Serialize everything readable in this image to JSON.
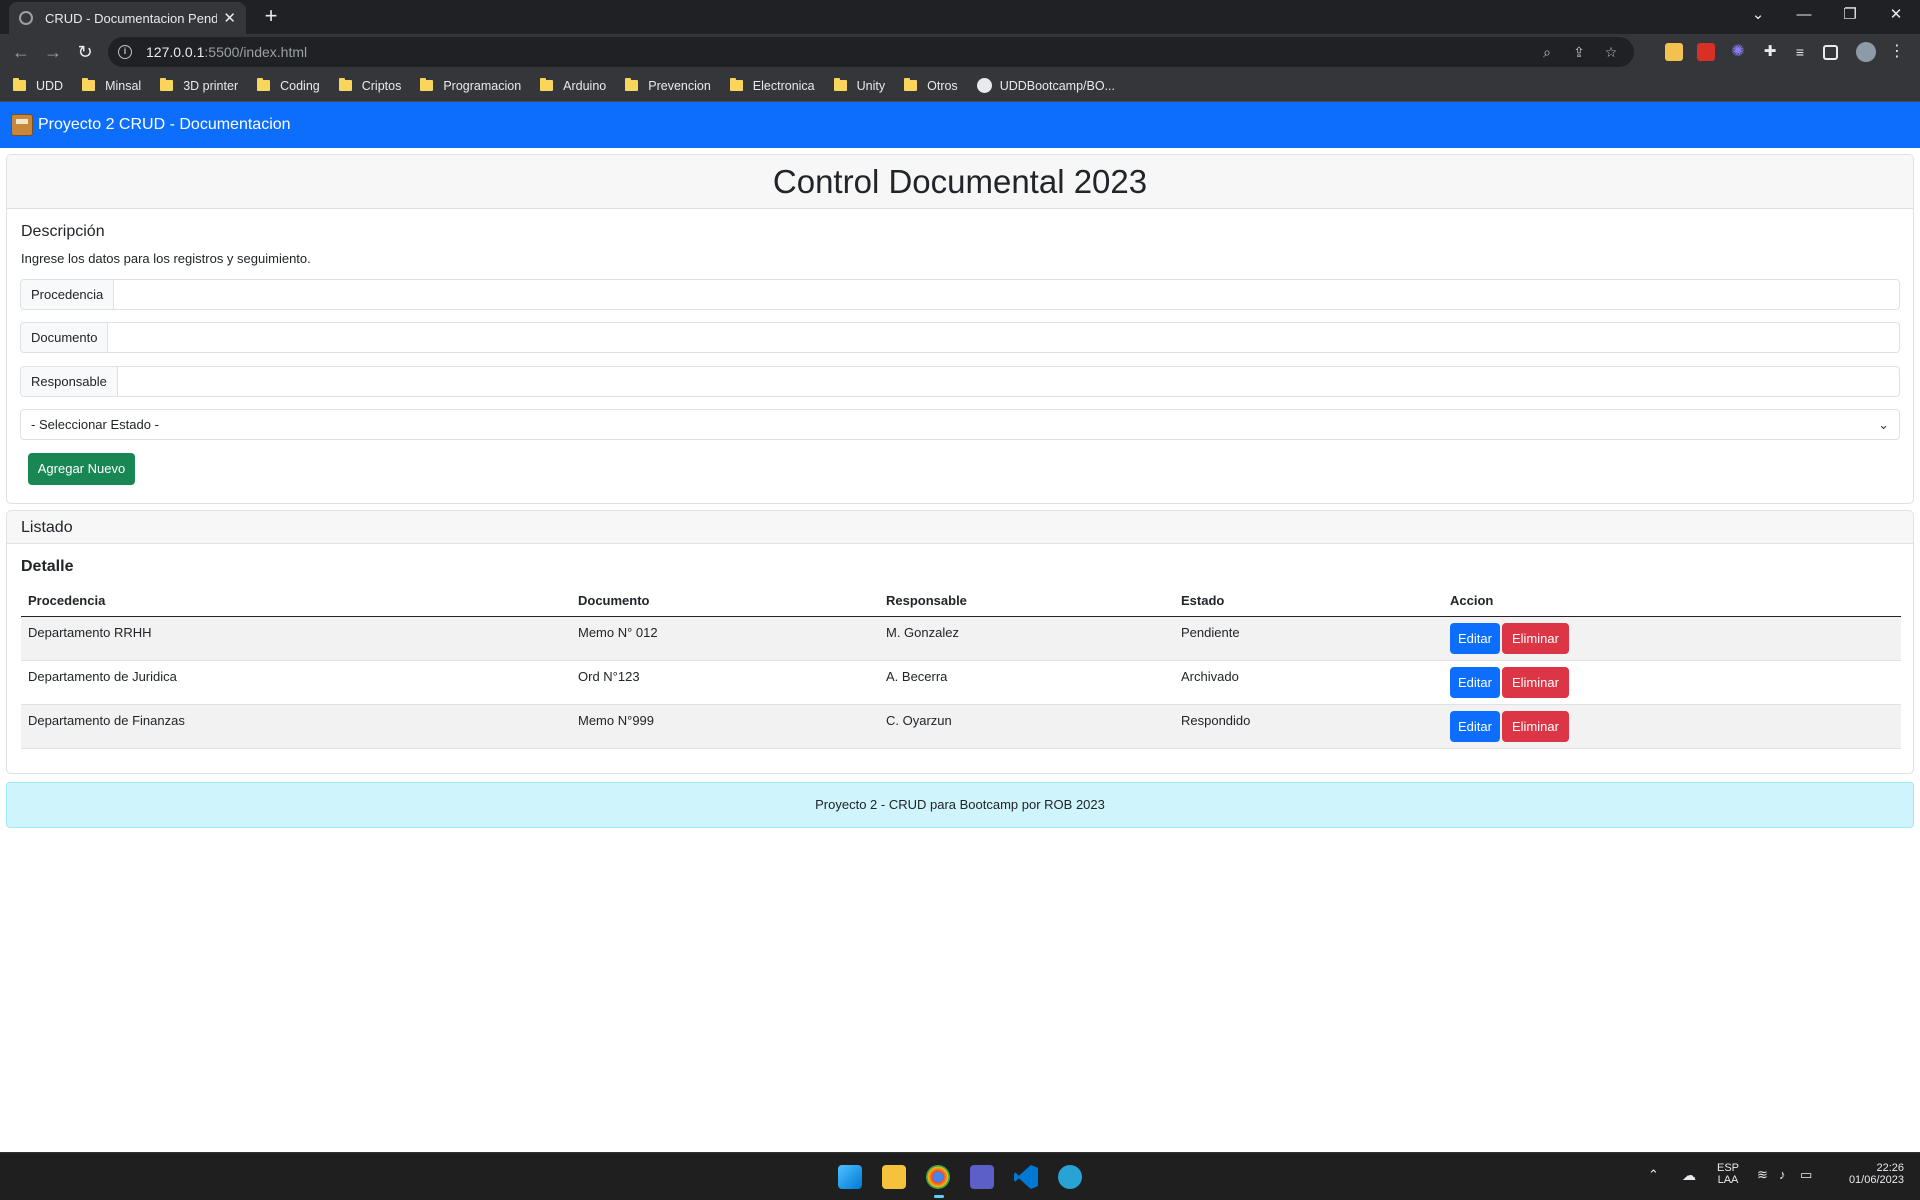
{
  "browser": {
    "tab_title": "CRUD - Documentacion Pendient",
    "tab_close": "✕",
    "new_tab": "+",
    "url_host": "127.0.0.1",
    "url_rest": ":5500/index.html",
    "controls": {
      "tabs_menu": "⌄",
      "minimize": "—",
      "restore": "❐",
      "close": "✕"
    },
    "nav": {
      "back": "←",
      "forward": "→",
      "reload": "↻"
    },
    "bookmarks": [
      {
        "label": "UDD",
        "icon": "folder-icon"
      },
      {
        "label": "Minsal",
        "icon": "folder-icon"
      },
      {
        "label": "3D printer",
        "icon": "folder-icon"
      },
      {
        "label": "Coding",
        "icon": "folder-icon"
      },
      {
        "label": "Criptos",
        "icon": "folder-icon"
      },
      {
        "label": "Programacion",
        "icon": "folder-icon"
      },
      {
        "label": "Arduino",
        "icon": "folder-icon"
      },
      {
        "label": "Prevencion",
        "icon": "folder-icon"
      },
      {
        "label": "Electronica",
        "icon": "folder-icon"
      },
      {
        "label": "Unity",
        "icon": "folder-icon"
      },
      {
        "label": "Otros",
        "icon": "folder-icon"
      },
      {
        "label": "UDDBootcamp/BO...",
        "icon": "github-icon"
      }
    ]
  },
  "app": {
    "title": "Proyecto 2 CRUD - Documentacion",
    "brand_color": "#0d6efd"
  },
  "form": {
    "heading": "Control Documental 2023",
    "description_title": "Descripción",
    "description_text": "Ingrese los datos para los registros y seguimiento.",
    "fields": {
      "procedencia": {
        "label": "Procedencia",
        "value": ""
      },
      "documento": {
        "label": "Documento",
        "value": ""
      },
      "responsable": {
        "label": "Responsable",
        "value": ""
      }
    },
    "estado_select": {
      "selected": "- Seleccionar Estado -"
    },
    "add_button": "Agregar Nuevo"
  },
  "listado": {
    "header": "Listado",
    "detail_title": "Detalle",
    "columns": [
      "Procedencia",
      "Documento",
      "Responsable",
      "Estado",
      "Accion"
    ],
    "rows": [
      {
        "procedencia": "Departamento RRHH",
        "documento": "Memo N° 012",
        "responsable": "M. Gonzalez",
        "estado": "Pendiente",
        "edit": "Editar",
        "delete": "Eliminar"
      },
      {
        "procedencia": "Departamento de Juridica",
        "documento": "Ord N°123",
        "responsable": "A. Becerra",
        "estado": "Archivado",
        "edit": "Editar",
        "delete": "Eliminar"
      },
      {
        "procedencia": "Departamento de Finanzas",
        "documento": "Memo N°999",
        "responsable": "C. Oyarzun",
        "estado": "Respondido",
        "edit": "Editar",
        "delete": "Eliminar"
      }
    ]
  },
  "footer": {
    "text": "Proyecto 2 - CRUD para Bootcamp por ROB 2023"
  },
  "taskbar": {
    "lang": "ESP",
    "layout": "LAA",
    "time": "22:26",
    "date": "01/06/2023"
  }
}
